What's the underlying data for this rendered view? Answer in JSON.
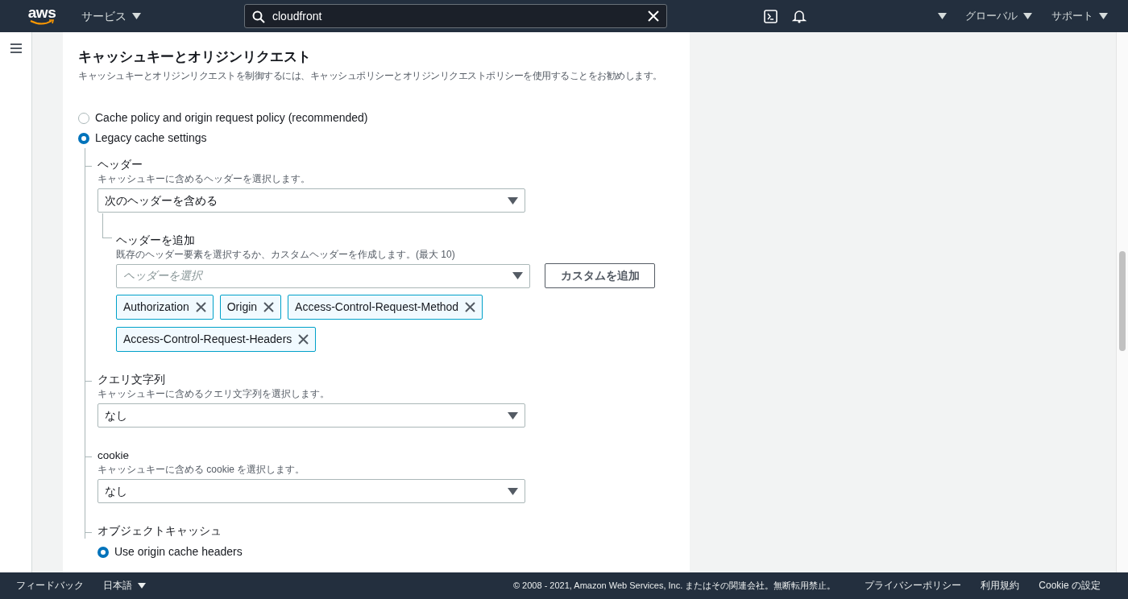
{
  "topbar": {
    "logo": "aws",
    "services": "サービス",
    "search": {
      "value": "cloudfront"
    },
    "region": "グローバル",
    "support": "サポート"
  },
  "section": {
    "title": "キャッシュキーとオリジンリクエスト",
    "description": "キャッシュキーとオリジンリクエストを制御するには、キャッシュポリシーとオリジンリクエストポリシーを使用することをお勧めします。",
    "cache_options": [
      {
        "label": "Cache policy and origin request policy (recommended)",
        "selected": false
      },
      {
        "label": "Legacy cache settings",
        "selected": true
      }
    ],
    "headers": {
      "label": "ヘッダー",
      "description": "キャッシュキーに含めるヘッダーを選択します。",
      "value": "次のヘッダーを含める",
      "add_header": {
        "label": "ヘッダーを追加",
        "description": "既存のヘッダー要素を選択するか、カスタムヘッダーを作成します。(最大 10)",
        "placeholder": "ヘッダーを選択",
        "button": "カスタムを追加",
        "tags": [
          "Authorization",
          "Origin",
          "Access-Control-Request-Method",
          "Access-Control-Request-Headers"
        ]
      }
    },
    "query_strings": {
      "label": "クエリ文字列",
      "description": "キャッシュキーに含めるクエリ文字列を選択します。",
      "value": "なし"
    },
    "cookie": {
      "label": "cookie",
      "description": "キャッシュキーに含める cookie を選択します。",
      "value": "なし"
    },
    "object_cache": {
      "label": "オブジェクトキャッシュ",
      "options": [
        {
          "label": "Use origin cache headers",
          "selected": true
        }
      ]
    }
  },
  "footer": {
    "feedback": "フィードバック",
    "language": "日本語",
    "copyright": "© 2008 - 2021, Amazon Web Services, Inc. またはその関連会社。無断転用禁止。",
    "links": [
      "プライバシーポリシー",
      "利用規約",
      "Cookie の設定"
    ]
  }
}
